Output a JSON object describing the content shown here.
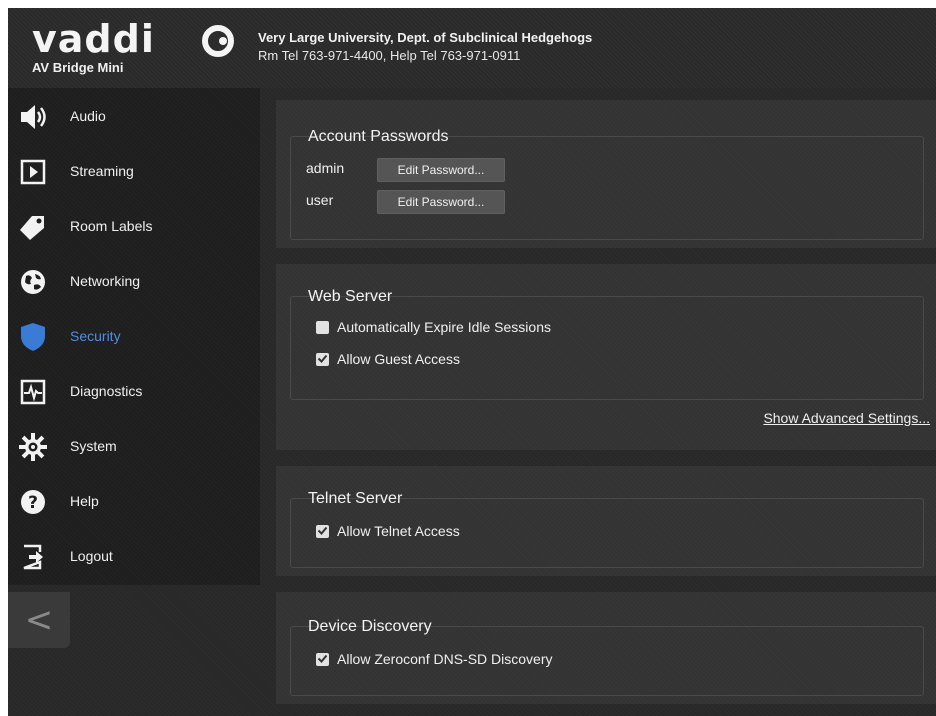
{
  "header": {
    "logo_text": "vaddio",
    "product": "AV Bridge Mini",
    "organization": "Very Large University, Dept. of Subclinical Hedgehogs",
    "contact": "Rm Tel 763-971-4400, Help Tel 763-971-0911"
  },
  "sidebar": {
    "items": [
      {
        "label": "Audio",
        "icon": "speaker-icon"
      },
      {
        "label": "Streaming",
        "icon": "play-icon"
      },
      {
        "label": "Room Labels",
        "icon": "tag-icon"
      },
      {
        "label": "Networking",
        "icon": "globe-icon"
      },
      {
        "label": "Security",
        "icon": "shield-icon",
        "active": true
      },
      {
        "label": "Diagnostics",
        "icon": "pulse-icon"
      },
      {
        "label": "System",
        "icon": "gear-icon"
      },
      {
        "label": "Help",
        "icon": "question-icon"
      },
      {
        "label": "Logout",
        "icon": "logout-icon"
      }
    ],
    "collapse_glyph": "<"
  },
  "account_passwords": {
    "title": "Account Passwords",
    "admin_label": "admin",
    "user_label": "user",
    "edit_label": "Edit Password..."
  },
  "web_server": {
    "title": "Web Server",
    "expire_sessions": {
      "label": "Automatically Expire Idle Sessions",
      "checked": false
    },
    "guest_access": {
      "label": "Allow Guest Access",
      "checked": true
    },
    "advanced_link": "Show Advanced Settings..."
  },
  "telnet_server": {
    "title": "Telnet Server",
    "telnet_access": {
      "label": "Allow Telnet Access",
      "checked": true
    }
  },
  "device_discovery": {
    "title": "Device Discovery",
    "zeroconf": {
      "label": "Allow Zeroconf DNS-SD Discovery",
      "checked": true
    }
  },
  "colors": {
    "active_nav": "#4d8fe6",
    "shield": "#3a7bd5"
  }
}
